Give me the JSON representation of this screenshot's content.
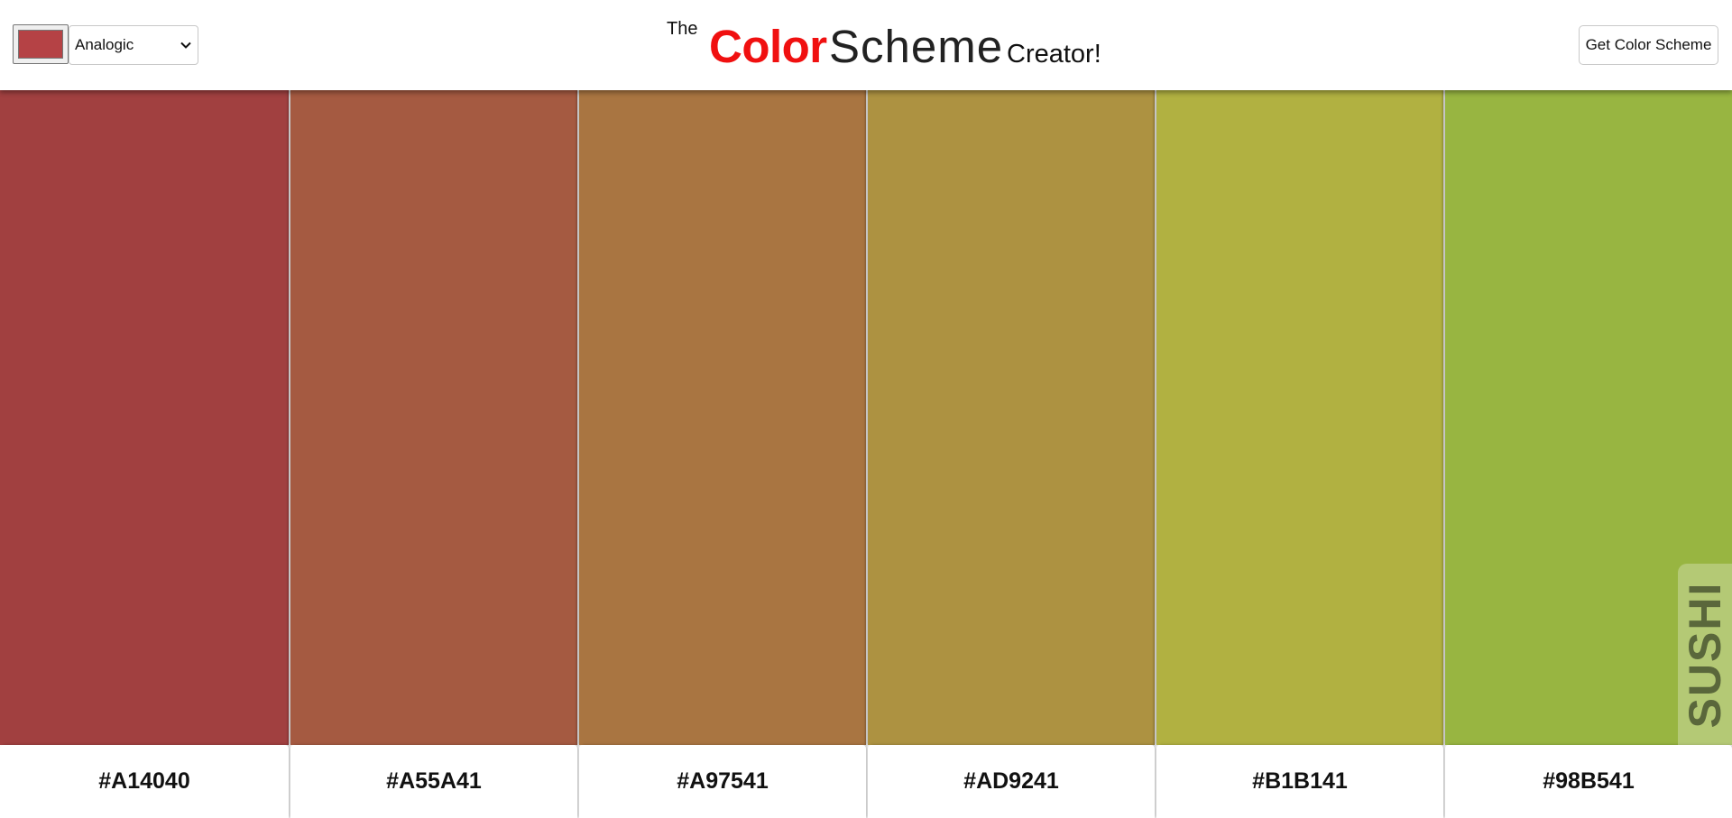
{
  "header": {
    "picker_color": "#B54245",
    "mode_value": "Analogic",
    "title_the": "The",
    "title_color": "Color",
    "title_scheme": "Scheme",
    "title_creator": "Creator!",
    "button_label": "Get Color Scheme"
  },
  "colors": [
    {
      "hex": "#A14040"
    },
    {
      "hex": "#A55A41"
    },
    {
      "hex": "#A97541"
    },
    {
      "hex": "#AD9241"
    },
    {
      "hex": "#B1B141"
    },
    {
      "hex": "#98B541"
    }
  ],
  "name_tag": "SUSHI"
}
